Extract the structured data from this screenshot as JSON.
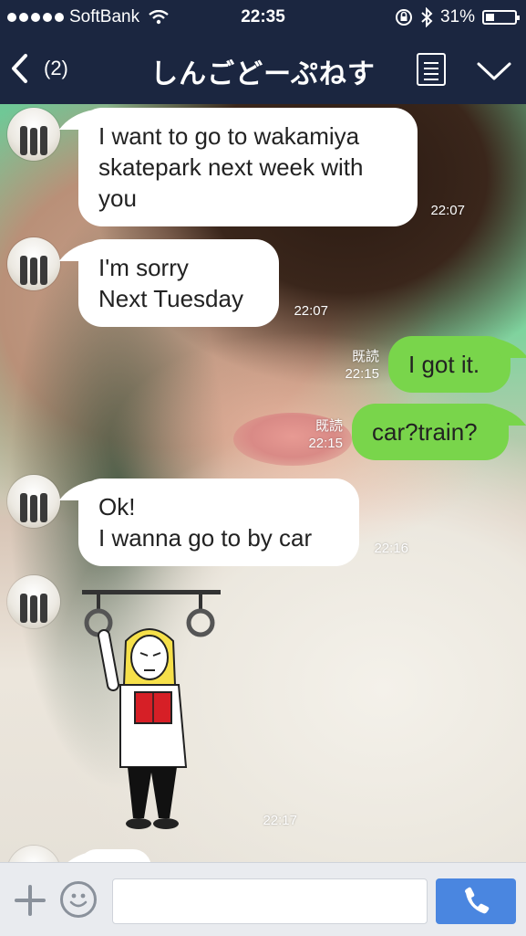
{
  "status_bar": {
    "carrier": "SoftBank",
    "time": "22:35",
    "battery_percent": "31%",
    "battery_level": 0.31,
    "signal_dots": 5
  },
  "header": {
    "back_count": "(2)",
    "title": "しんごどーぷねす"
  },
  "messages": [
    {
      "side": "in",
      "text": "I want to go to wakamiya\nskatepark next week with\nyou",
      "time": "22:07"
    },
    {
      "side": "in",
      "text": "I'm sorry\nNext Tuesday",
      "time": "22:07"
    },
    {
      "side": "out",
      "text": "I got it.",
      "read": "既読",
      "time": "22:15"
    },
    {
      "side": "out",
      "text": "car?train?",
      "read": "既読",
      "time": "22:15"
    },
    {
      "side": "in",
      "text": "Ok!\nI wanna go to by car",
      "time": "22:16"
    },
    {
      "side": "in",
      "type": "sticker",
      "time": "22:17"
    }
  ],
  "input": {
    "value": "",
    "placeholder": ""
  },
  "icons": {
    "back": "chevron-left-icon",
    "menu": "list-icon",
    "dropdown": "chevron-down-icon",
    "plus": "plus-icon",
    "emoji": "smiley-icon",
    "call": "phone-icon"
  },
  "colors": {
    "header": "#1b2640",
    "outgoing_bubble": "#79d54b",
    "incoming_bubble": "#ffffff",
    "call_button": "#4a86e0"
  }
}
